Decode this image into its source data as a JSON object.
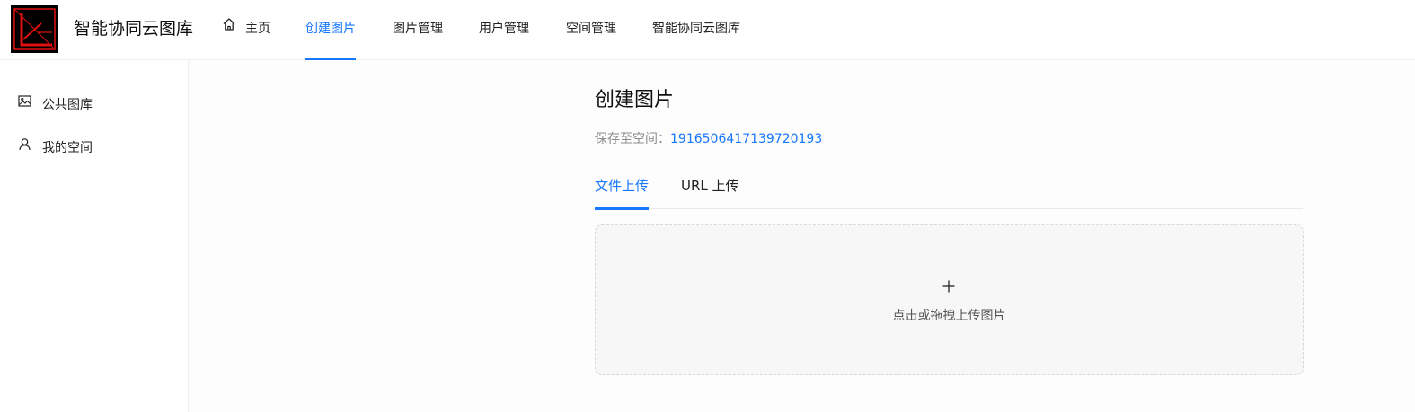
{
  "header": {
    "app_title": "智能协同云图库",
    "nav": [
      {
        "label": "主页",
        "icon": "home-icon"
      },
      {
        "label": "创建图片",
        "active": true
      },
      {
        "label": "图片管理"
      },
      {
        "label": "用户管理"
      },
      {
        "label": "空间管理"
      },
      {
        "label": "智能协同云图库"
      }
    ]
  },
  "sidebar": {
    "items": [
      {
        "label": "公共图库",
        "icon": "image-icon"
      },
      {
        "label": "我的空间",
        "icon": "user-icon"
      }
    ]
  },
  "main": {
    "title": "创建图片",
    "space_label": "保存至空间：",
    "space_id": "1916506417139720193",
    "tabs": [
      {
        "label": "文件上传",
        "active": true
      },
      {
        "label": "URL 上传"
      }
    ],
    "upload_hint": "点击或拖拽上传图片"
  },
  "colors": {
    "accent": "#1677ff",
    "logo_bg": "#000000",
    "logo_mark": "#e01010"
  }
}
